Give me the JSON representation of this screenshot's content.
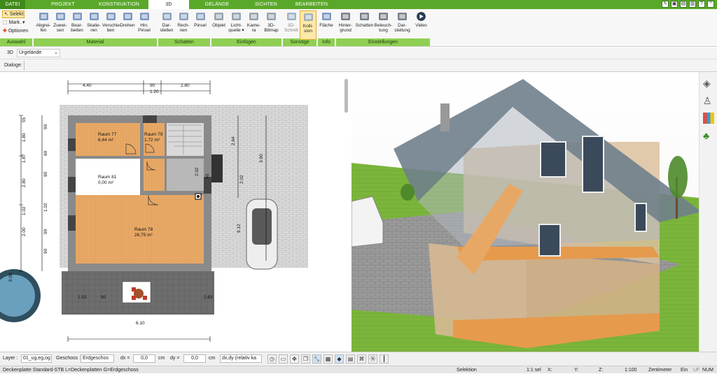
{
  "tabs": [
    {
      "label": "DATEI"
    },
    {
      "label": "PROJEKT"
    },
    {
      "label": "KONSTRUKTION"
    },
    {
      "label": "3D"
    },
    {
      "label": "GELÄNDE"
    },
    {
      "label": "SICHTEN"
    },
    {
      "label": "BEARBEITEN"
    }
  ],
  "ribbon": {
    "auswahl": {
      "selekt": "Selekt",
      "mark": "Mark.",
      "optionen": "Optionen",
      "group": "Auswahl"
    },
    "material": {
      "items": [
        "Abgrei-\nfen",
        "Zuwei-\nsen",
        "Bear-\nbeiten",
        "Skalie-\nren",
        "Verschie-\nben",
        "Drehen",
        "Hin.\nPinsel"
      ],
      "group": "Material"
    },
    "schatten": {
      "items": [
        "Dar-\nstellen",
        "Rech-\nnen",
        "Pinsel"
      ],
      "group": "Schatten"
    },
    "einfuegen": {
      "items": [
        "Objekt",
        "Licht-\nquelle ▾",
        "Kame-\nra",
        "3D-\nBitmap"
      ],
      "group": "Einfügen"
    },
    "sonstige": {
      "items": [
        "3D-\nSchnitt",
        "Kolli-\nsion"
      ],
      "group": "Sonstige"
    },
    "info": {
      "items": [
        "Fläche"
      ],
      "group": "Info"
    },
    "einstellungen": {
      "items": [
        "Hinter-\ngrund",
        "Schatten",
        "Beleuch-\ntung",
        "Dar-\nstellung",
        "Video"
      ],
      "group": "Einstellungen"
    }
  },
  "row3d": {
    "label": "3D",
    "select_value": "Urgelände"
  },
  "dialoge": {
    "label": "Dialoge:"
  },
  "plan": {
    "dims_top": [
      "4.40",
      "90",
      "1.20",
      "2.80"
    ],
    "dims_left": [
      "1.80",
      "55",
      "1.87",
      "2.80",
      "1.02",
      "2.00",
      "9.00"
    ],
    "dims_left2": [
      "90",
      "60",
      "90",
      "1.02",
      "90",
      "90"
    ],
    "dims_right": [
      "2.64",
      "3.90",
      "2.02",
      "9.12"
    ],
    "dims_inner": [
      "2.02",
      "90"
    ],
    "dims_bottom": [
      "1.53",
      "90",
      "2.63",
      "6.10"
    ],
    "rooms": [
      {
        "name": "Raum 77",
        "area": "6,44 m²"
      },
      {
        "name": "Raum 79",
        "area": "1,72 m²"
      },
      {
        "name": "Raum 81",
        "area": "0,00 m²"
      },
      {
        "name": "Raum 78",
        "area": "26,75 m²"
      }
    ]
  },
  "status": {
    "layer_label": "Layer :",
    "layer_value": "01_ug,eg,og",
    "geschoss_label": "Geschoss :",
    "geschoss_value": "Erdgeschos",
    "dx_label": "dx =",
    "dx_value": "0,0",
    "dy_label": "dy =",
    "dy_value": "0,0",
    "unit": "cm",
    "mode_value": "dx,dy (relativ ka"
  },
  "statusline": {
    "info": "Deckenplatte Standard-STB L=Deckenplatten G=Erdgeschoss",
    "mode": "Selektion",
    "sel": "1:1 sel",
    "x": "X:",
    "y": "Y:",
    "z": "Z:",
    "scale": "1:100",
    "unit": "Zentimeter",
    "ein": "Ein",
    "uf": "UF",
    "num": "NUM"
  },
  "colors": {
    "accent": "#5aa82a",
    "group": "#8fcf52",
    "floor": "#e8a865",
    "wall": "#8a8a8a"
  }
}
